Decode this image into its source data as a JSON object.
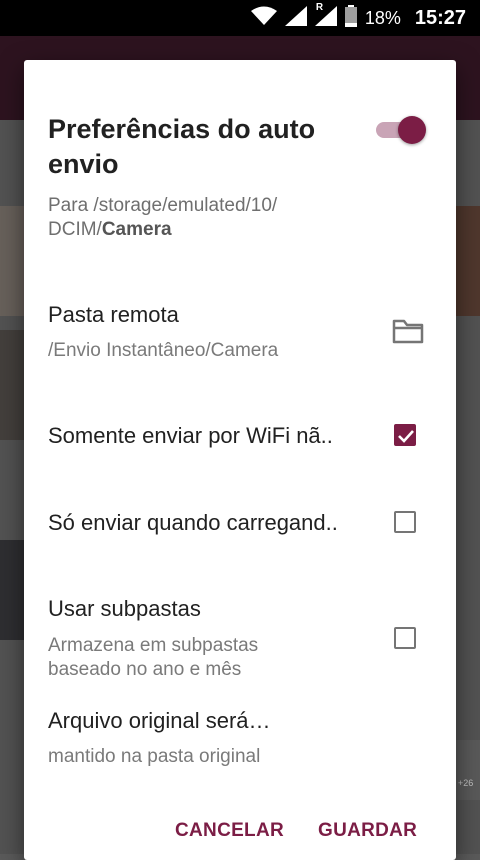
{
  "status_bar": {
    "battery": "18%",
    "time": "15:27",
    "signal_label": "R"
  },
  "dialog": {
    "title": "Preferências do auto envio",
    "toggle_on": true,
    "path_prefix": "Para /storage/emulated/10/ DCIM/",
    "path_bold": "Camera",
    "remote_folder": {
      "title": "Pasta remota",
      "value": "/Envio Instantâneo/Camera"
    },
    "wifi_only": {
      "label": "Somente enviar por WiFi nã..",
      "checked": true
    },
    "charging_only": {
      "label": "Só enviar quando carregand..",
      "checked": false
    },
    "subfolders": {
      "title": "Usar subpastas",
      "description": "Armazena em subpastas baseado no ano e mês",
      "checked": false
    },
    "original_file": {
      "title": "Arquivo original será…",
      "value": "mantido na pasta original"
    },
    "buttons": {
      "cancel": "CANCELAR",
      "save": "GUARDAR"
    }
  },
  "colors": {
    "accent": "#7b1d45",
    "toggle_track": "#c9a4b6"
  },
  "background_badge": "+26"
}
